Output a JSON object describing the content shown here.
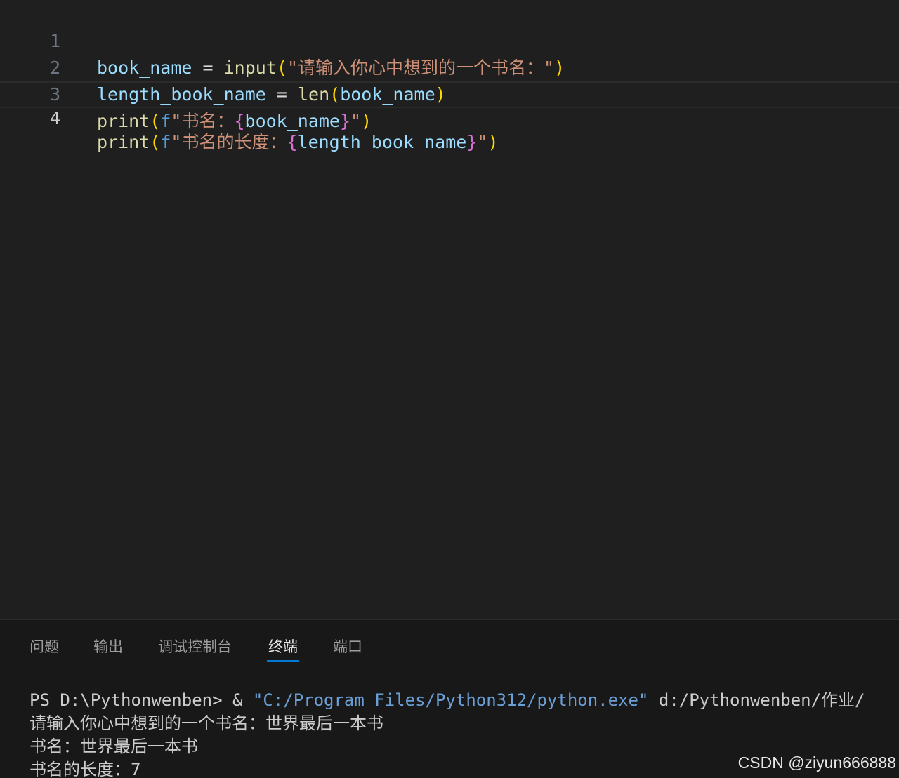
{
  "editor": {
    "lines": [
      {
        "number": "1",
        "tokens": [
          "book_name",
          " = ",
          "input",
          "(",
          "\"请输入你心中想到的一个书名：\"",
          ")"
        ]
      },
      {
        "number": "2",
        "tokens": [
          "length_book_name",
          " = ",
          "len",
          "(",
          "book_name",
          ")"
        ]
      },
      {
        "number": "3",
        "tokens": [
          "print",
          "(",
          "f",
          "\"书名：",
          "{",
          "book_name",
          "}",
          "\"",
          ")"
        ]
      },
      {
        "number": "4",
        "tokens": [
          "print",
          "(",
          "f",
          "\"书名的长度：",
          "{",
          "length_book_name",
          "}",
          "\"",
          ")"
        ]
      }
    ]
  },
  "panel": {
    "tabs": [
      "问题",
      "输出",
      "调试控制台",
      "终端",
      "端口"
    ],
    "active_tab": "终端"
  },
  "terminal": {
    "command": {
      "prompt": "PS D:\\Pythonwenben> & ",
      "exe": "\"C:/Program Files/Python312/python.exe\"",
      "args": " d:/Pythonwenben/作业/"
    },
    "output": [
      "请输入你心中想到的一个书名：世界最后一本书",
      "书名：世界最后一本书",
      "书名的长度：7"
    ]
  },
  "watermark": "CSDN @ziyun666888",
  "colors": {
    "editor_bg": "#1f1f1f",
    "panel_bg": "#181818",
    "active_tab_underline": "#0078d4",
    "variable": "#9cdcfe",
    "function": "#dcdcaa",
    "string": "#ce9178"
  }
}
